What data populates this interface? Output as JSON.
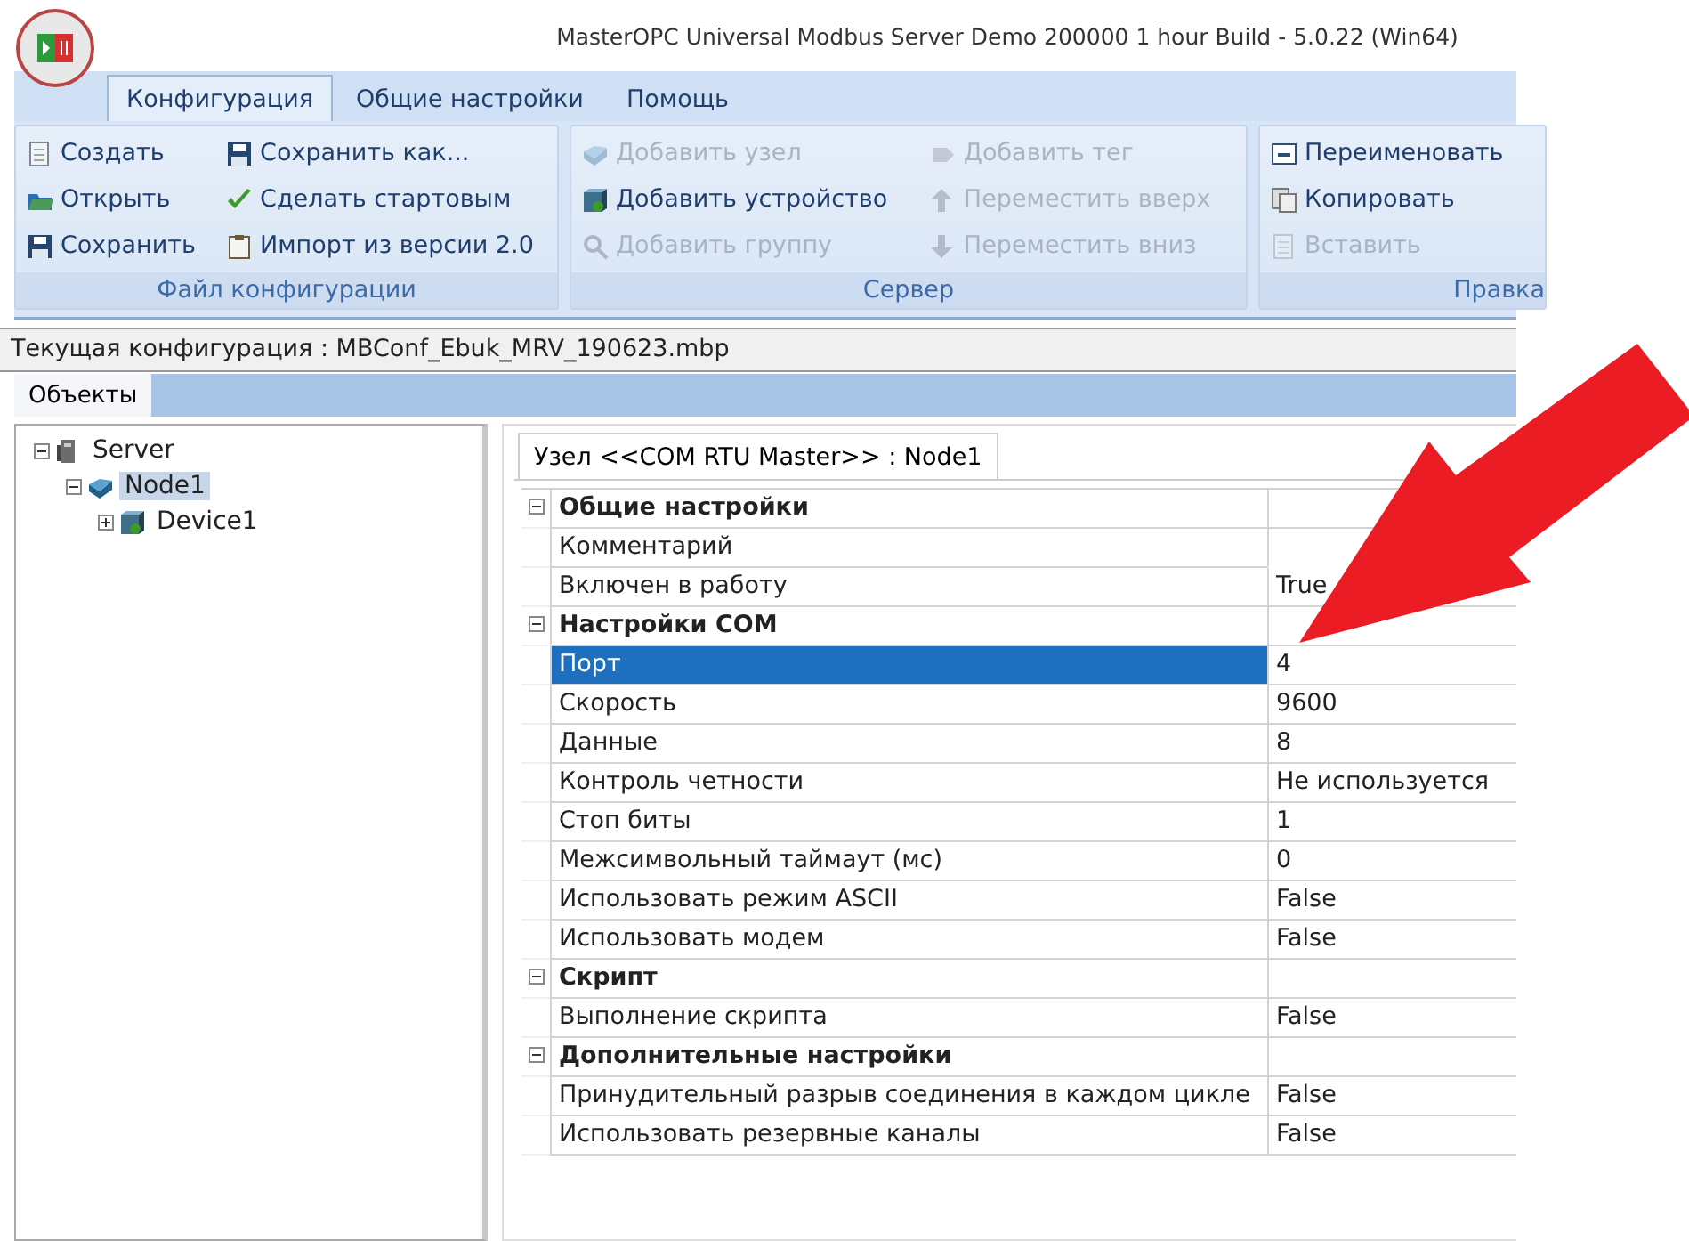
{
  "window": {
    "title": "MasterOPC Universal Modbus Server Demo 200000 1 hour Build - 5.0.22 (Win64)"
  },
  "app_tabs": [
    {
      "label": "Конфигурация",
      "selected": true
    },
    {
      "label": "Общие настройки",
      "selected": false
    },
    {
      "label": "Помощь",
      "selected": false
    }
  ],
  "ribbon_groups": [
    {
      "label": "Файл конфигурации",
      "items": [
        {
          "label": "Создать",
          "disabled": false
        },
        {
          "label": "Открыть",
          "disabled": false
        },
        {
          "label": "Сохранить",
          "disabled": false
        },
        {
          "label": "Сохранить как...",
          "disabled": false
        },
        {
          "label": "Сделать стартовым",
          "disabled": false
        },
        {
          "label": "Импорт из версии 2.0",
          "disabled": false
        }
      ]
    },
    {
      "label": "Сервер",
      "items": [
        {
          "label": "Добавить узел",
          "disabled": true
        },
        {
          "label": "Добавить устройство",
          "disabled": false
        },
        {
          "label": "Добавить группу",
          "disabled": true
        },
        {
          "label": "Добавить тег",
          "disabled": true
        },
        {
          "label": "Переместить вверх",
          "disabled": true
        },
        {
          "label": "Переместить вниз",
          "disabled": true
        }
      ]
    },
    {
      "label": "Правка",
      "items": [
        {
          "label": "Переименовать",
          "disabled": false
        },
        {
          "label": "Копировать",
          "disabled": false
        },
        {
          "label": "Вставить",
          "disabled": true
        }
      ]
    }
  ],
  "current_config": "Текущая конфигурация : MBConf_Ebuk_MRV_190623.mbp",
  "panel_tabs": [
    {
      "label": "Объекты",
      "selected": true
    }
  ],
  "tree": [
    {
      "label": "Server",
      "expanded": true,
      "selected": false,
      "children": [
        {
          "label": "Node1",
          "expanded": true,
          "selected": true,
          "children": [
            {
              "label": "Device1",
              "expanded": false,
              "selected": false
            }
          ]
        }
      ]
    }
  ],
  "editor_tab": {
    "label": "Узел <<COM RTU Master>> : Node1",
    "selected": true
  },
  "property_sections": [
    {
      "title": "Общие настройки",
      "expanded": true,
      "rows": [
        {
          "name": "Комментарий",
          "value": "",
          "selected": false
        },
        {
          "name": "Включен в работу",
          "value": "True",
          "selected": false
        }
      ]
    },
    {
      "title": "Настройки COM",
      "expanded": true,
      "rows": [
        {
          "name": "Порт",
          "value": "4",
          "selected": true
        },
        {
          "name": "Скорость",
          "value": "9600",
          "selected": false
        },
        {
          "name": "Данные",
          "value": "8",
          "selected": false
        },
        {
          "name": "Контроль четности",
          "value": "Не используется",
          "selected": false
        },
        {
          "name": "Стоп биты",
          "value": "1",
          "selected": false
        },
        {
          "name": "Межсимвольный таймаут (мс)",
          "value": "0",
          "selected": false
        },
        {
          "name": "Использовать режим ASCII",
          "value": "False",
          "selected": false
        },
        {
          "name": "Использовать модем",
          "value": "False",
          "selected": false
        }
      ]
    },
    {
      "title": "Скрипт",
      "expanded": true,
      "rows": [
        {
          "name": "Выполнение скрипта",
          "value": "False",
          "selected": false
        }
      ]
    },
    {
      "title": "Дополнительные настройки",
      "expanded": true,
      "rows": [
        {
          "name": "Принудительный разрыв соединения в каждом цикле",
          "value": "False",
          "selected": false
        },
        {
          "name": "Использовать резервные каналы",
          "value": "False",
          "selected": false
        }
      ]
    }
  ]
}
